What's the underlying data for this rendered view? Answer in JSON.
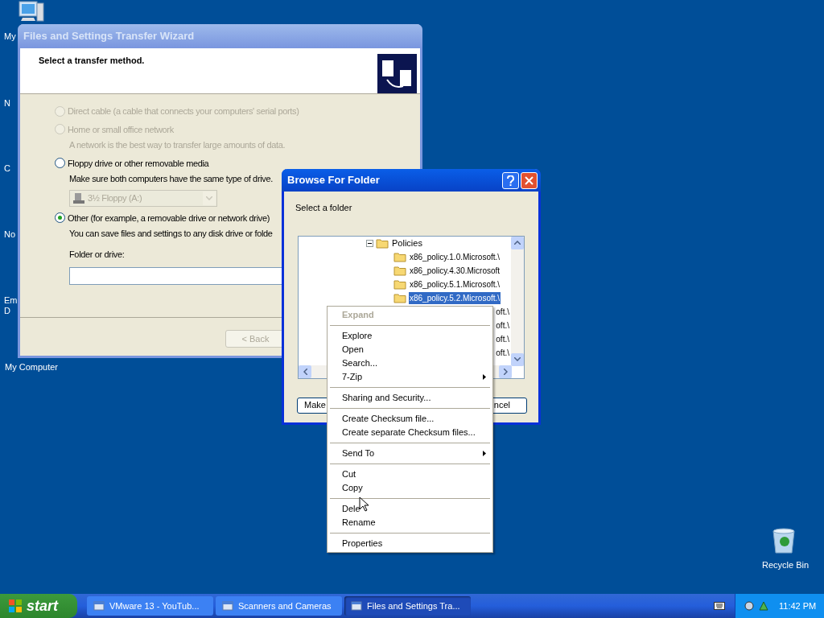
{
  "desktop_labels": [
    {
      "label": "My"
    },
    {
      "label": "N"
    },
    {
      "label": "C"
    },
    {
      "label": "No"
    },
    {
      "label": "Em"
    },
    {
      "label": "D"
    }
  ],
  "desktop_icons": [
    {
      "label": "My Computer",
      "kind": "computer"
    },
    {
      "label": "Recycle Bin",
      "kind": "recycle"
    }
  ],
  "wizard": {
    "title": "Files and Settings Transfer Wizard",
    "heading": "Select a transfer method.",
    "options": [
      {
        "label": "Direct cable (a cable that connects your computers' serial ports)",
        "selected": false,
        "disabled": true
      },
      {
        "label": "Home or small office network",
        "selected": false,
        "disabled": true,
        "description": "A network is the best way to transfer large amounts of data."
      },
      {
        "label": "Floppy drive or other removable media",
        "selected": false,
        "disabled": false,
        "description": "Make sure both computers have the same type of drive.",
        "dropdown": {
          "value": "3½ Floppy (A:)",
          "disabled": true
        }
      },
      {
        "label": "Other (for example, a removable drive or network drive)",
        "selected": true,
        "disabled": false,
        "description": "You can save files and settings to any disk drive or folde",
        "field": {
          "label": "Folder or drive:"
        }
      }
    ],
    "back_button": {
      "label": "< Back",
      "disabled": true
    }
  },
  "browse": {
    "title": "Select a folder",
    "window_title": "Browse For Folder",
    "tree": [
      {
        "label": "Policies",
        "expanded": true,
        "selected": false,
        "children": [
          {
            "label": "x86_policy.1.0.Microsoft.\\",
            "selected": false
          },
          {
            "label": "x86_policy.4.30.Microsoft",
            "selected": false
          },
          {
            "label": "x86_policy.5.1.Microsoft.\\",
            "selected": false
          },
          {
            "label": "x86_policy.5.2.Microsoft.\\",
            "selected": true
          },
          {
            "label": "oft.\\",
            "selected": false
          },
          {
            "label": "oft.\\",
            "selected": false
          },
          {
            "label": "oft.\\",
            "selected": false
          },
          {
            "label": "oft.\\",
            "selected": false
          }
        ]
      }
    ],
    "buttons": [
      "Make",
      "ncel"
    ]
  },
  "context_menu": [
    {
      "kind": "item",
      "label": "Expand",
      "disabled": true,
      "submenu": false
    },
    {
      "kind": "separator"
    },
    {
      "kind": "item",
      "label": "Explore",
      "disabled": false,
      "submenu": false
    },
    {
      "kind": "item",
      "label": "Open",
      "disabled": false,
      "submenu": false
    },
    {
      "kind": "item",
      "label": "Search...",
      "disabled": false,
      "submenu": false
    },
    {
      "kind": "item",
      "label": "7-Zip",
      "disabled": false,
      "submenu": true
    },
    {
      "kind": "separator"
    },
    {
      "kind": "item",
      "label": "Sharing and Security...",
      "disabled": false,
      "submenu": false
    },
    {
      "kind": "separator"
    },
    {
      "kind": "item",
      "label": "Create Checksum file...",
      "disabled": false,
      "submenu": false
    },
    {
      "kind": "item",
      "label": "Create separate Checksum files...",
      "disabled": false,
      "submenu": false
    },
    {
      "kind": "separator"
    },
    {
      "kind": "item",
      "label": "Send To",
      "disabled": false,
      "submenu": true
    },
    {
      "kind": "separator"
    },
    {
      "kind": "item",
      "label": "Cut",
      "disabled": false,
      "submenu": false
    },
    {
      "kind": "item",
      "label": "Copy",
      "disabled": false,
      "submenu": false
    },
    {
      "kind": "separator"
    },
    {
      "kind": "item",
      "label": "Dele",
      "disabled": false,
      "submenu": false
    },
    {
      "kind": "item",
      "label": "Rename",
      "disabled": false,
      "submenu": false
    },
    {
      "kind": "separator"
    },
    {
      "kind": "item",
      "label": "Properties",
      "disabled": false,
      "submenu": false
    }
  ],
  "taskbar": {
    "start": "start",
    "tasks": [
      {
        "label": "VMware 13 - YouTub...",
        "selected": false
      },
      {
        "label": "Scanners and Cameras",
        "selected": false
      },
      {
        "label": "Files and Settings Tra...",
        "selected": true
      }
    ],
    "clock": "11:42 PM"
  }
}
